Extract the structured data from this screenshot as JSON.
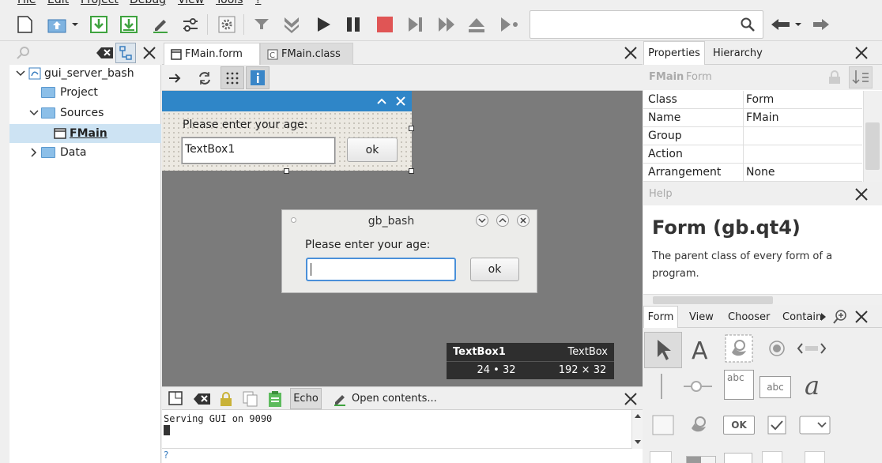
{
  "menu": [
    "File",
    "Edit",
    "Project",
    "Debug",
    "View",
    "Tools",
    "?"
  ],
  "project": {
    "root": "gui_server_bash",
    "items": [
      {
        "label": "Project"
      },
      {
        "label": "Sources"
      },
      {
        "label": "FMain"
      },
      {
        "label": "Data"
      }
    ]
  },
  "editor_tabs": [
    "FMain.form",
    "FMain.class"
  ],
  "design_form": {
    "prompt": "Please enter your age:",
    "textbox_value": "TextBox1",
    "button": "ok"
  },
  "run_window": {
    "title": "gb_bash",
    "prompt": "Please enter your age:",
    "input_value": "",
    "button": "ok"
  },
  "selection_info": {
    "name": "TextBox1",
    "class": "TextBox",
    "position": "24 • 32",
    "size": "192 × 32"
  },
  "console": {
    "echo_label": "Echo",
    "open_label": "Open contents...",
    "output": "Serving GUI on 9090",
    "prompt": "?"
  },
  "right_tabs": [
    "Properties",
    "Hierarchy"
  ],
  "properties_header": {
    "name": "FMain",
    "class": "Form"
  },
  "properties": [
    {
      "name": "Class",
      "value": "Form"
    },
    {
      "name": "Name",
      "value": "FMain"
    },
    {
      "name": "Group",
      "value": ""
    },
    {
      "name": "Action",
      "value": ""
    },
    {
      "name": "Arrangement",
      "value": "None"
    }
  ],
  "help": {
    "label": "Help",
    "title": "Form (gb.qt4)",
    "text": "The parent class of every form of a program."
  },
  "toolbox_tabs": [
    "Form",
    "View",
    "Chooser",
    "Contain"
  ],
  "toolbox_labels": {
    "abc1": "abc",
    "abc2": "abc",
    "ok": "OK"
  }
}
